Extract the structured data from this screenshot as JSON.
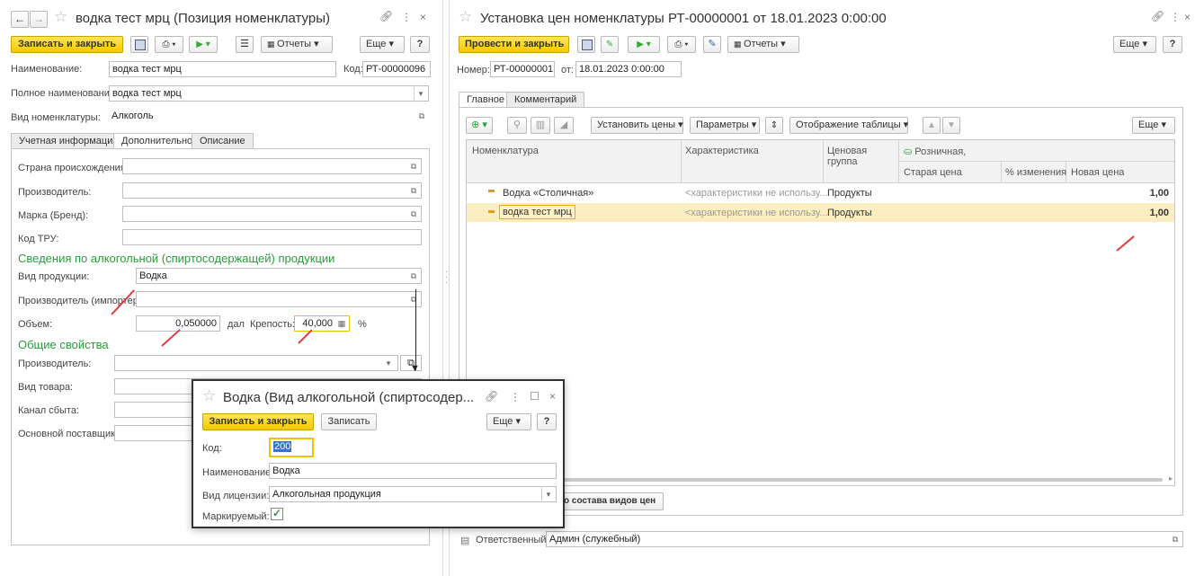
{
  "left": {
    "title": "водка тест мрц (Позиция номенклатуры)",
    "save_close": "Записать и закрыть",
    "reports": "Отчеты",
    "more": "Еще",
    "help": "?",
    "name_label": "Наименование:",
    "name_value": "водка тест мрц",
    "code_label": "Код:",
    "code_value": "РТ-00000096",
    "fullname_label": "Полное наименование:",
    "fullname_value": "водка тест мрц",
    "kind_label": "Вид номенклатуры:",
    "kind_value": "Алкоголь",
    "tabs": [
      "Учетная информация",
      "Дополнительно",
      "Описание"
    ],
    "country_label": "Страна происхождения:",
    "producer_label": "Производитель:",
    "brand_label": "Марка (Бренд):",
    "tru_label": "Код ТРУ:",
    "alco_section": "Сведения по алкогольной (спиртосодержащей) продукции",
    "product_kind_label": "Вид продукции:",
    "product_kind_value": "Водка",
    "importer_label": "Производитель (импортер):",
    "volume_label": "Объем:",
    "volume_value": "0,050000",
    "volume_unit": "дал",
    "strength_label": "Крепость:",
    "strength_value": "40,000",
    "strength_unit": "%",
    "common_section": "Общие свойства",
    "producer2_label": "Производитель:",
    "goods_kind_label": "Вид товара:",
    "channel_label": "Канал сбыта:",
    "supplier_label": "Основной поставщик:"
  },
  "right": {
    "title": "Установка цен номенклатуры РТ-00000001 от 18.01.2023 0:00:00",
    "post_close": "Провести и закрыть",
    "reports": "Отчеты",
    "more": "Еще",
    "help": "?",
    "number_label": "Номер:",
    "number_value": "РТ-00000001",
    "from_label": "от:",
    "date_value": "18.01.2023  0:00:00",
    "tabs": [
      "Главное",
      "Комментарий"
    ],
    "set_prices": "Установить цены",
    "params": "Параметры",
    "table_view": "Отображение таблицы",
    "more2": "Еще",
    "col_nom": "Номенклатура",
    "col_char": "Характеристика",
    "col_group": "Ценовая группа",
    "col_retail": "Розничная,",
    "col_old": "Старая цена",
    "col_pct": "% изменения",
    "col_new": "Новая цена",
    "rows": [
      {
        "nom": "Водка «Столичная»",
        "char": "<характеристики не использу...",
        "group": "Продукты",
        "new": "1,00"
      },
      {
        "nom": "водка тест мрц",
        "char": "<характеристики не использу...",
        "group": "Продукты",
        "new": "1,00"
      }
    ],
    "compose_btn": "о состава видов цен",
    "responsible_label": "Ответственный:",
    "responsible_value": "Админ (служебный)"
  },
  "popup": {
    "title": "Водка (Вид алкогольной (спиртосодер...",
    "save_close": "Записать и закрыть",
    "save": "Записать",
    "more": "Еще",
    "help": "?",
    "code_label": "Код:",
    "code_value": "200",
    "name_label": "Наименование:",
    "name_value": "Водка",
    "license_label": "Вид лицензии:",
    "license_value": "Алкогольная продукция",
    "marked_label": "Маркируемый:"
  }
}
